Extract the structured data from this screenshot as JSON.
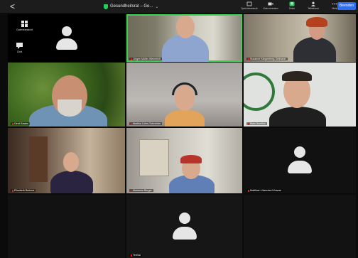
{
  "topbar": {
    "back_glyph": "<",
    "meeting_title": "Gesundheitsrat – Ge...",
    "chevron": "⌄",
    "items": [
      {
        "icon": "speaker-view-icon",
        "label": "Sprecheransicht"
      },
      {
        "icon": "video-icon",
        "label": "Video beenden"
      },
      {
        "icon": "share-icon",
        "label": "Teilen"
      },
      {
        "icon": "participants-icon",
        "label": "Teilnehmer"
      },
      {
        "icon": "more-icon",
        "label": "Mehr"
      }
    ],
    "leave_label": "Beenden"
  },
  "controls": [
    {
      "icon": "grid-icon",
      "label": "Galerieansicht"
    },
    {
      "icon": "chat-icon",
      "label": "Chat"
    }
  ],
  "participants": [
    {
      "name": "",
      "kind": "avatar"
    },
    {
      "name": "Jürgen Müller-Weinreich",
      "kind": "video"
    },
    {
      "name": "Susanne Klingenberg-Sellmann",
      "kind": "video"
    },
    {
      "name": "Gerd Kasten",
      "kind": "video"
    },
    {
      "name": "Martina Lührs-Schneider",
      "kind": "video"
    },
    {
      "name": "Marc Aurelius",
      "kind": "video"
    },
    {
      "name": "Elisabeth Brehme",
      "kind": "video"
    },
    {
      "name": "Marianne Berger",
      "kind": "video"
    },
    {
      "name": "Matthias Lützendorf-Krause",
      "kind": "avatar"
    },
    {
      "name": "Teresa",
      "kind": "avatar"
    }
  ],
  "colors": {
    "active_speaker": "#39d353",
    "leave": "#2d6ef6",
    "muted": "#e02020"
  }
}
